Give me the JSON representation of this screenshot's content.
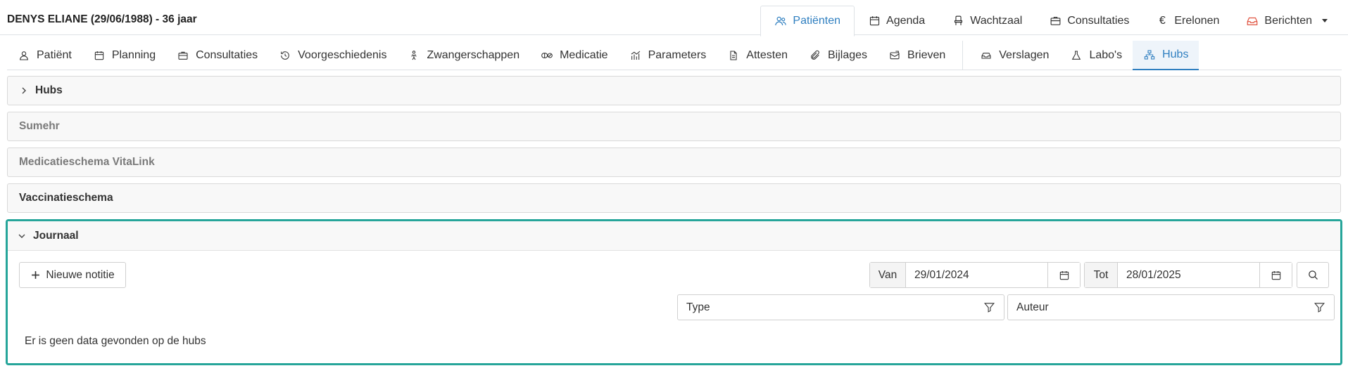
{
  "header": {
    "patient_title": "DENYS ELIANE (29/06/1988) - 36 jaar"
  },
  "main_nav": {
    "items": [
      {
        "label": "Patiënten",
        "icon": "users-icon"
      },
      {
        "label": "Agenda",
        "icon": "calendar-icon"
      },
      {
        "label": "Wachtzaal",
        "icon": "chair-icon"
      },
      {
        "label": "Consultaties",
        "icon": "briefcase-icon"
      },
      {
        "label": "Erelonen",
        "icon": "euro-icon"
      },
      {
        "label": "Berichten",
        "icon": "inbox-icon"
      }
    ],
    "active": "Patiënten",
    "accent_color": "#2f7fc0",
    "alert_color": "#e0523f"
  },
  "sub_tabs": {
    "items": [
      {
        "label": "Patiënt"
      },
      {
        "label": "Planning"
      },
      {
        "label": "Consultaties"
      },
      {
        "label": "Voorgeschiedenis"
      },
      {
        "label": "Zwangerschappen"
      },
      {
        "label": "Medicatie"
      },
      {
        "label": "Parameters"
      },
      {
        "label": "Attesten"
      },
      {
        "label": "Bijlages"
      },
      {
        "label": "Brieven"
      },
      {
        "label": "Verslagen"
      },
      {
        "label": "Labo's"
      },
      {
        "label": "Hubs"
      }
    ],
    "active": "Hubs"
  },
  "panels": {
    "hubs": "Hubs",
    "sumehr": "Sumehr",
    "medicatieschema": "Medicatieschema VitaLink",
    "vaccinatieschema": "Vaccinatieschema"
  },
  "journal": {
    "title": "Journaal",
    "border_color": "#26a59a",
    "new_note_label": "Nieuwe notitie",
    "van_label": "Van",
    "van_value": "29/01/2024",
    "tot_label": "Tot",
    "tot_value": "28/01/2025",
    "type_placeholder": "Type",
    "auteur_placeholder": "Auteur",
    "empty_message": "Er is geen data gevonden op de hubs"
  }
}
